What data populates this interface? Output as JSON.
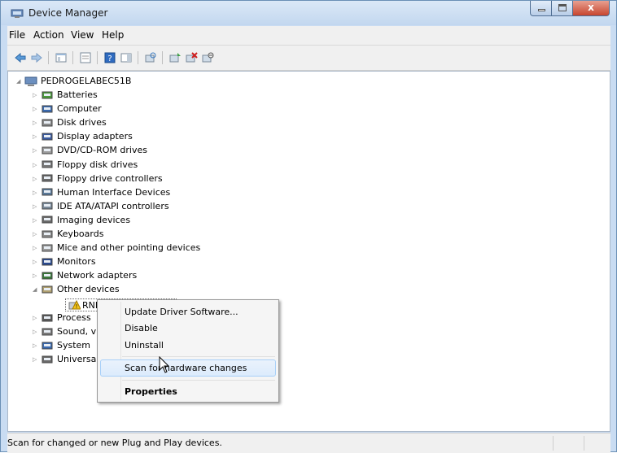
{
  "window": {
    "title": "Device Manager",
    "close_glyph": "x",
    "icons": [
      "device-manager-icon",
      "minimize-icon",
      "maximize-icon",
      "close-icon"
    ]
  },
  "menubar": {
    "items": [
      "File",
      "Action",
      "View",
      "Help"
    ]
  },
  "toolbar": {
    "icons": [
      "back-arrow-icon",
      "forward-arrow-icon",
      "show-hide-console-tree-icon",
      "properties-icon",
      "help-icon",
      "show-action-pane-icon",
      "scan-hardware-icon",
      "update-driver-icon",
      "uninstall-icon",
      "disable-device-icon"
    ]
  },
  "tree": {
    "root": "PEDROGELABEC51B",
    "categories": [
      {
        "label": "Batteries",
        "icon": "battery-icon"
      },
      {
        "label": "Computer",
        "icon": "computer-icon"
      },
      {
        "label": "Disk drives",
        "icon": "disk-drive-icon"
      },
      {
        "label": "Display adapters",
        "icon": "display-adapter-icon"
      },
      {
        "label": "DVD/CD-ROM drives",
        "icon": "dvd-drive-icon"
      },
      {
        "label": "Floppy disk drives",
        "icon": "floppy-disk-icon"
      },
      {
        "label": "Floppy drive controllers",
        "icon": "floppy-controller-icon"
      },
      {
        "label": "Human Interface Devices",
        "icon": "hid-icon"
      },
      {
        "label": "IDE ATA/ATAPI controllers",
        "icon": "ide-controller-icon"
      },
      {
        "label": "Imaging devices",
        "icon": "imaging-device-icon"
      },
      {
        "label": "Keyboards",
        "icon": "keyboard-icon"
      },
      {
        "label": "Mice and other pointing devices",
        "icon": "mouse-icon"
      },
      {
        "label": "Monitors",
        "icon": "monitor-icon"
      },
      {
        "label": "Network adapters",
        "icon": "network-adapter-icon"
      },
      {
        "label": "Other devices",
        "icon": "other-devices-icon"
      }
    ],
    "selected_device": {
      "label": "RND",
      "icon": "warning-device-icon"
    },
    "after": [
      {
        "label": "Process",
        "icon": "processor-icon"
      },
      {
        "label": "Sound, v",
        "icon": "sound-icon"
      },
      {
        "label": "System",
        "icon": "system-device-icon"
      },
      {
        "label": "Universa",
        "icon": "usb-icon"
      }
    ]
  },
  "context_menu": {
    "items": [
      {
        "label": "Update Driver Software..."
      },
      {
        "label": "Disable"
      },
      {
        "label": "Uninstall"
      },
      {
        "label": "Scan for hardware changes"
      },
      {
        "label": "Properties"
      }
    ],
    "hovered_index": 3
  },
  "statusbar": {
    "text": "Scan for changed or new Plug and Play devices."
  },
  "colors": {
    "title_bar": "#c2d7ef",
    "close_button": "#c7452f",
    "menu_hover": "#dcebfc",
    "menu_hover_border": "#a8d0f8"
  }
}
